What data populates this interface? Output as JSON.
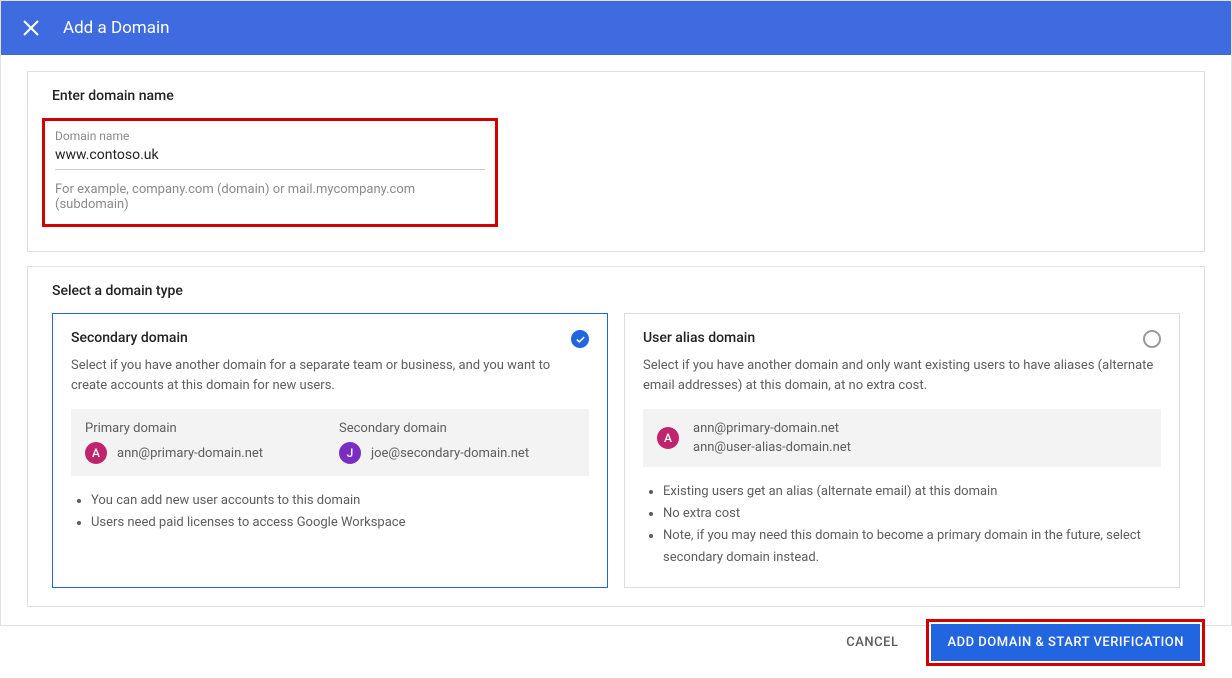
{
  "header": {
    "title": "Add a Domain"
  },
  "enterDomain": {
    "sectionLabel": "Enter domain name",
    "fieldLabel": "Domain name",
    "value": "www.contoso.uk",
    "hint": "For example, company.com (domain) or mail.mycompany.com (subdomain)"
  },
  "selectType": {
    "sectionLabel": "Select a domain type",
    "secondary": {
      "title": "Secondary domain",
      "desc": "Select if you have another domain for a separate team or business, and you want to create accounts at this domain for new users.",
      "primaryLabel": "Primary domain",
      "primaryEmail": "ann@primary-domain.net",
      "secondaryLabel": "Secondary domain",
      "secondaryEmail": "joe@secondary-domain.net",
      "bullets": [
        "You can add new user accounts to this domain",
        "Users need paid licenses to access Google Workspace"
      ]
    },
    "alias": {
      "title": "User alias domain",
      "desc": "Select if you have another domain and only want existing users to have aliases (alternate email addresses) at this domain, at no extra cost.",
      "email1": "ann@primary-domain.net",
      "email2": "ann@user-alias-domain.net",
      "bullets": [
        "Existing users get an alias (alternate email) at this domain",
        "No extra cost",
        "Note, if you may need this domain to become a primary domain in the future, select secondary domain instead."
      ]
    }
  },
  "footer": {
    "cancel": "CANCEL",
    "submit": "ADD DOMAIN & START VERIFICATION"
  },
  "avatarLetter": "A",
  "avatarLetterJ": "J"
}
